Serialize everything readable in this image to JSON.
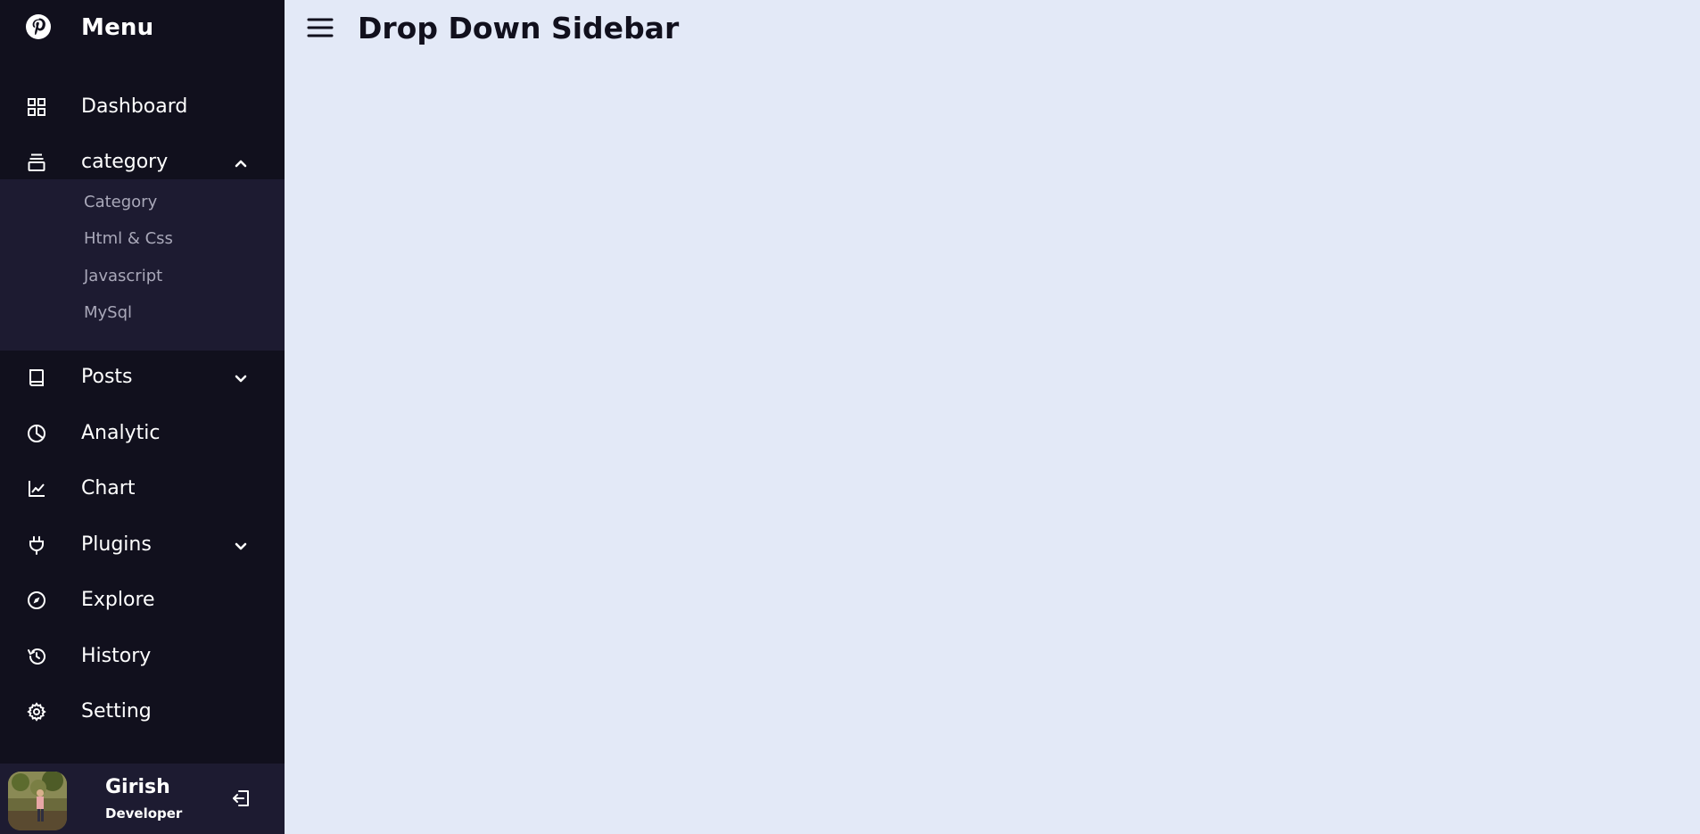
{
  "sidebar": {
    "logo_name": "Menu",
    "items": [
      {
        "label": "Dashboard",
        "icon": "grid-icon"
      },
      {
        "label": "category",
        "icon": "collection-icon",
        "expanded": true
      },
      {
        "label": "Posts",
        "icon": "book-icon",
        "expanded": false
      },
      {
        "label": "Analytic",
        "icon": "pie-chart-icon"
      },
      {
        "label": "Chart",
        "icon": "line-chart-icon"
      },
      {
        "label": "Plugins",
        "icon": "plug-icon",
        "expanded": false
      },
      {
        "label": "Explore",
        "icon": "compass-icon"
      },
      {
        "label": "History",
        "icon": "history-icon"
      },
      {
        "label": "Setting",
        "icon": "gear-icon"
      }
    ],
    "submenu": [
      "Category",
      "Html & Css",
      "Javascript",
      "MySql"
    ]
  },
  "profile": {
    "name": "Girish",
    "job": "Developer"
  },
  "header": {
    "title": "Drop Down Sidebar"
  },
  "colors": {
    "sidebar_bg": "#11101d",
    "submenu_bg": "#1d1b31",
    "page_bg": "#e3e9f7",
    "submenu_text": "#a9a8b9"
  }
}
